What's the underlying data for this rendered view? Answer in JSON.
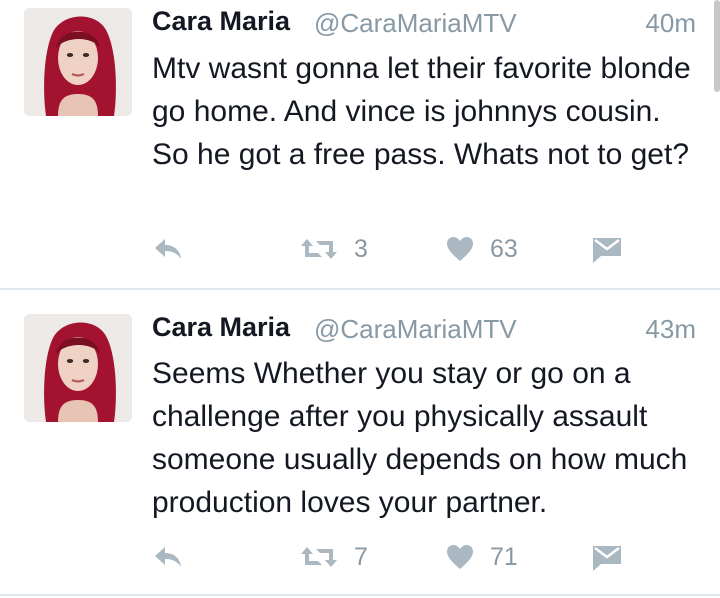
{
  "tweets": [
    {
      "name": "Cara Maria",
      "handle": "@CaraMariaMTV",
      "time": "40m",
      "text": "Mtv wasnt gonna let their favorite blonde go home. And vince is johnnys cousin. So he got a free pass. Whats not to get?",
      "retweets": "3",
      "likes": "63"
    },
    {
      "name": "Cara Maria",
      "handle": "@CaraMariaMTV",
      "time": "43m",
      "text": "Seems Whether you stay or go on a challenge after you physically assault someone usually depends on how much production loves your partner.",
      "retweets": "7",
      "likes": "71"
    }
  ],
  "icons": {
    "reply": "reply-icon",
    "retweet": "retweet-icon",
    "like": "heart-icon",
    "message": "direct-message-icon"
  },
  "colors": {
    "text": "#141823",
    "muted": "#8899a6",
    "icon": "#aab8c2",
    "divider": "#e1e8ed"
  }
}
